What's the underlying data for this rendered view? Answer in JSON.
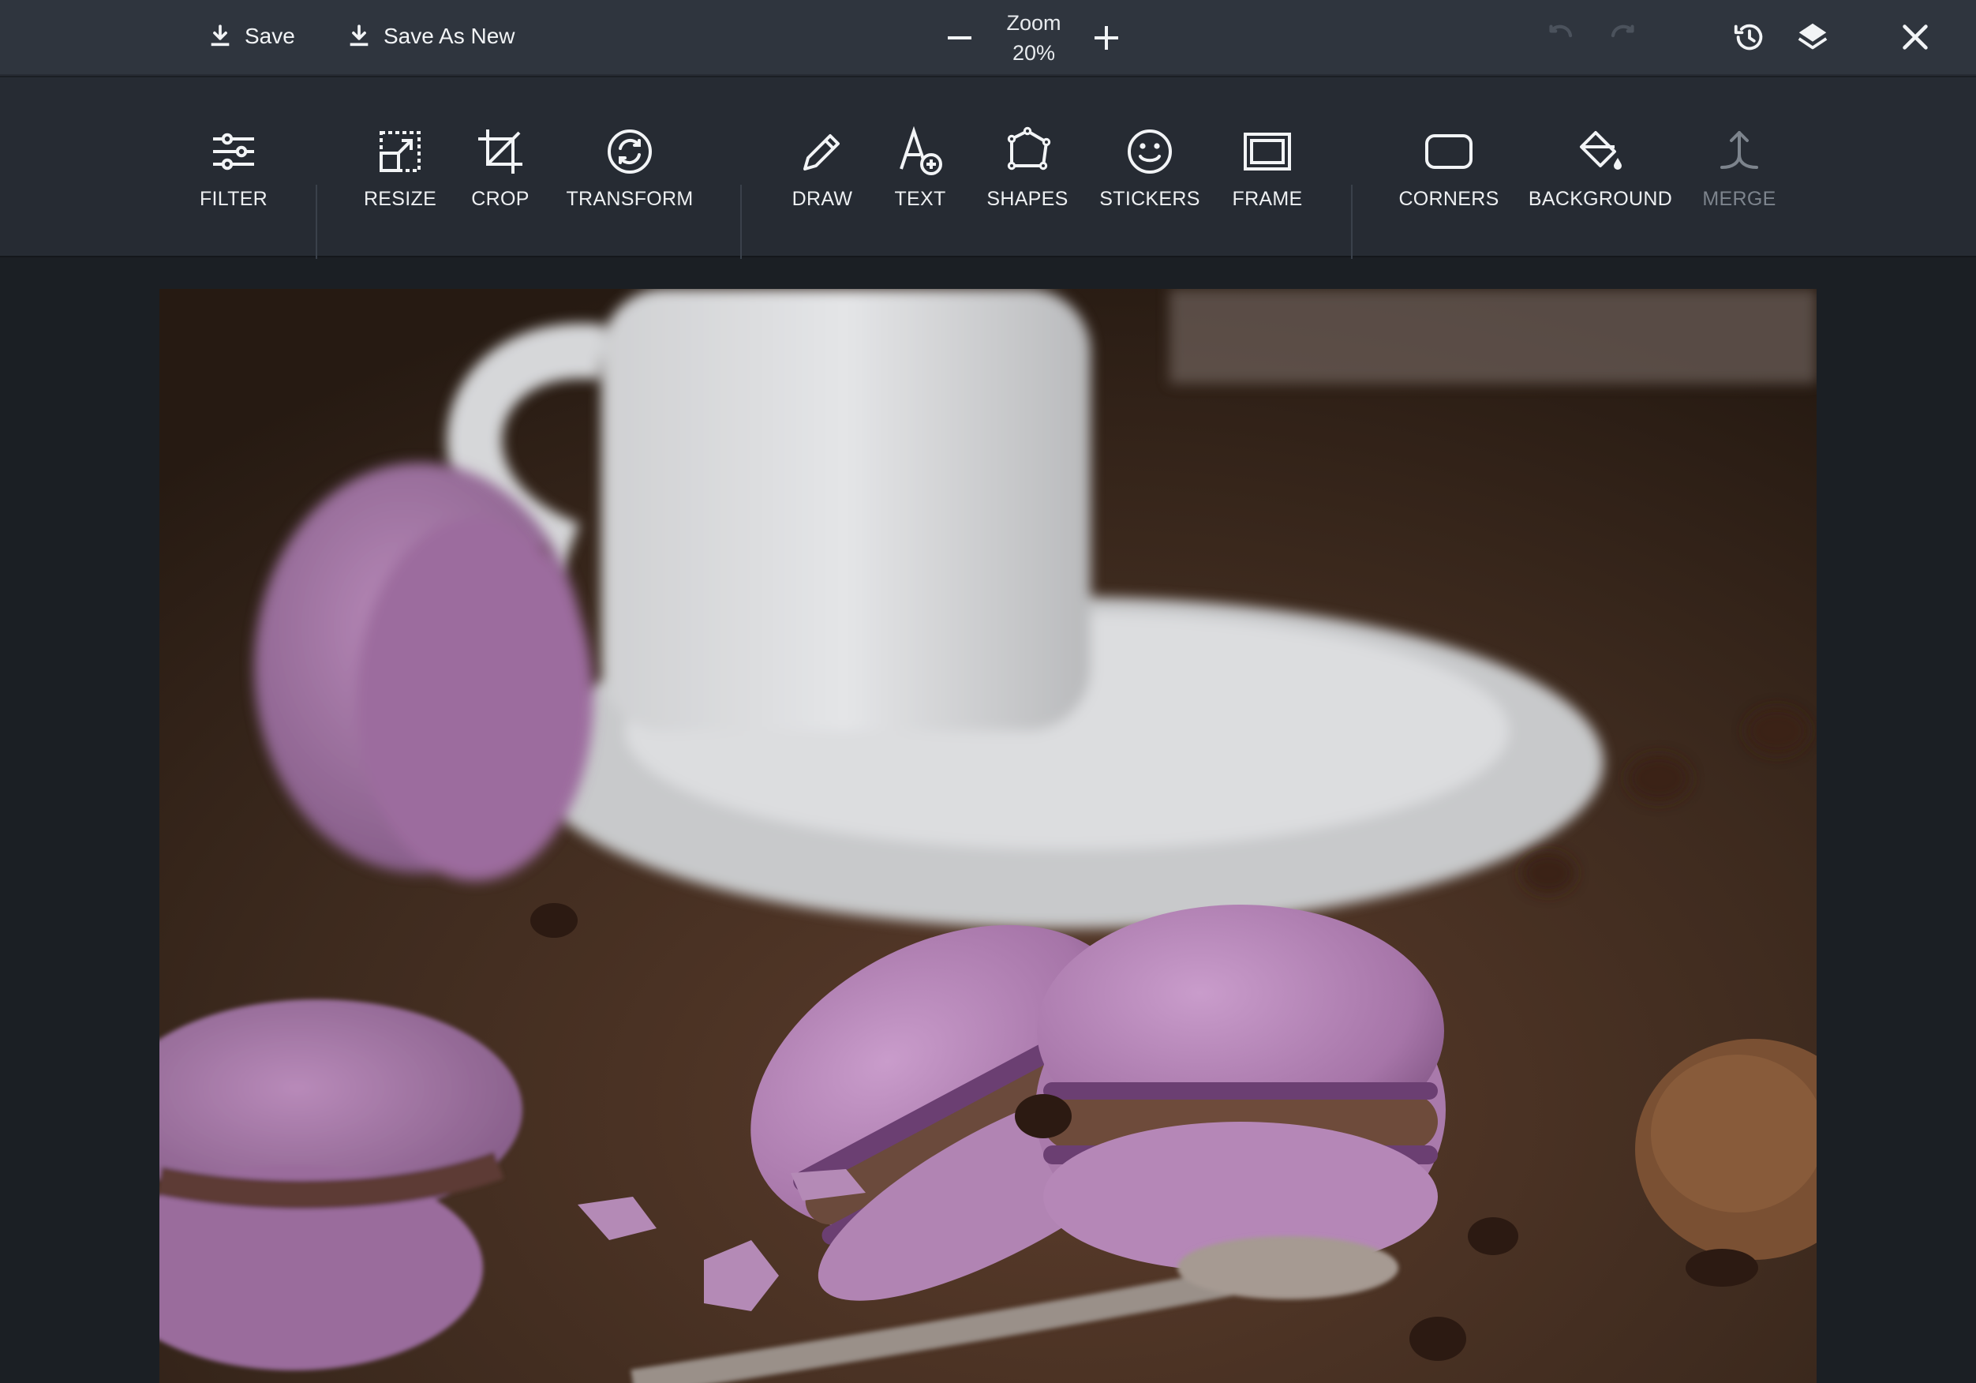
{
  "topbar": {
    "save_label": "Save",
    "save_as_new_label": "Save As New",
    "zoom_label": "Zoom",
    "zoom_value": "20%"
  },
  "tools": [
    {
      "label": "FILTER",
      "icon": "sliders-icon"
    },
    {
      "label": "RESIZE",
      "icon": "resize-icon"
    },
    {
      "label": "CROP",
      "icon": "crop-icon"
    },
    {
      "label": "TRANSFORM",
      "icon": "rotate-icon"
    },
    {
      "label": "DRAW",
      "icon": "pencil-icon"
    },
    {
      "label": "TEXT",
      "icon": "text-add-icon"
    },
    {
      "label": "SHAPES",
      "icon": "polygon-icon"
    },
    {
      "label": "STICKERS",
      "icon": "smiley-icon"
    },
    {
      "label": "FRAME",
      "icon": "frame-icon"
    },
    {
      "label": "CORNERS",
      "icon": "rounded-rect-icon"
    },
    {
      "label": "BACKGROUND",
      "icon": "paint-bucket-icon"
    },
    {
      "label": "MERGE",
      "icon": "merge-icon"
    }
  ],
  "colors": {
    "topbar_bg": "#2f353e",
    "toolbar_bg": "#262b33",
    "canvas_bg": "#1b1f24",
    "text": "#f2f4f6",
    "disabled_text": "#7d848d"
  }
}
